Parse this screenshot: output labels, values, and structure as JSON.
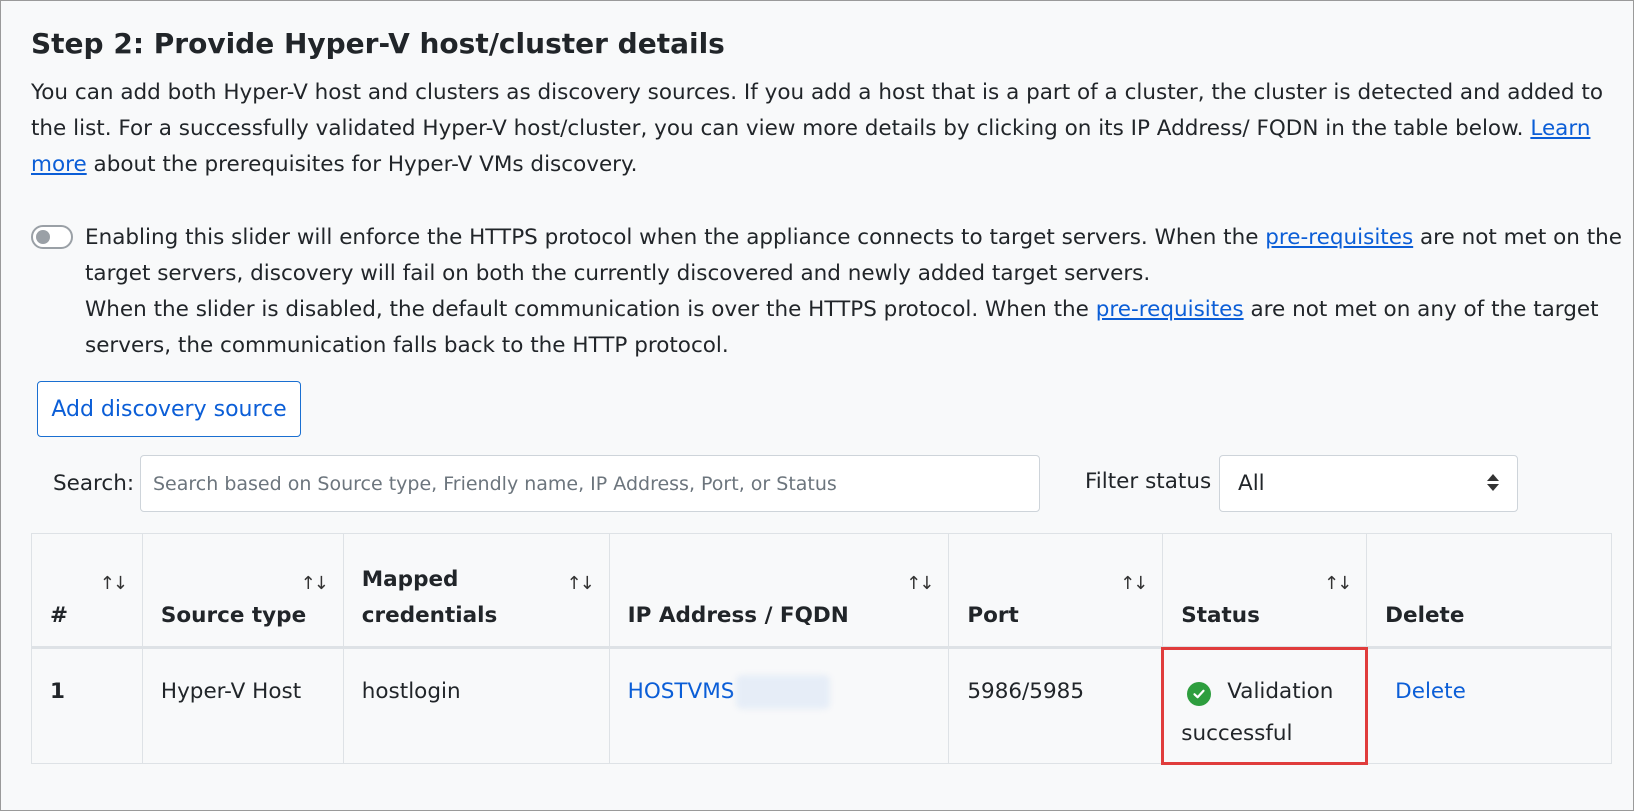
{
  "page": {
    "title": "Step 2: Provide Hyper-V host/cluster details",
    "intro_text": "You can add both Hyper-V host and clusters as discovery sources. If you add a host that is a part of a cluster, the cluster is detected and added to the list. For a successfully validated Hyper-V host/cluster, you can view more details by clicking on its IP Address/ FQDN in the table below. ",
    "intro_link": "Learn more",
    "intro_text_end": " about the prerequisites for Hyper-V VMs discovery."
  },
  "https_toggle": {
    "enabled": false,
    "text_part1": "Enabling this slider will enforce the HTTPS protocol when the appliance connects to target servers. When the ",
    "link1": "pre-requisites",
    "text_part2": " are not met on the target servers, discovery will fail on both the currently discovered and newly added target servers.",
    "text_part3": "When the slider is disabled, the default communication is over the HTTPS protocol. When the ",
    "link2": "pre-requisites",
    "text_part4": " are not met on any of the target servers, the communication falls back to the HTTP protocol."
  },
  "toolbar": {
    "add_button": "Add discovery source",
    "search_label": "Search:",
    "search_placeholder": "Search based on Source type, Friendly name, IP Address, Port, or Status",
    "search_value": "",
    "filter_label": "Filter status",
    "filter_value": "All"
  },
  "table": {
    "columns": [
      "#",
      "Source type",
      "Mapped credentials",
      "IP Address / FQDN",
      "Port",
      "Status",
      "Delete"
    ],
    "sort_icon": "↑↓",
    "rows": [
      {
        "num": "1",
        "source_type": "Hyper-V Host",
        "credentials": "hostlogin",
        "ip_fqdn": "HOSTVMS",
        "port": "5986/5985",
        "status": "Validation successful",
        "status_icon": "check-circle-icon",
        "status_color": "#2e9e3e",
        "delete": "Delete"
      }
    ]
  },
  "colors": {
    "link": "#0b5ed7",
    "highlight": "#e03c3c",
    "background": "#f8f9fa"
  }
}
